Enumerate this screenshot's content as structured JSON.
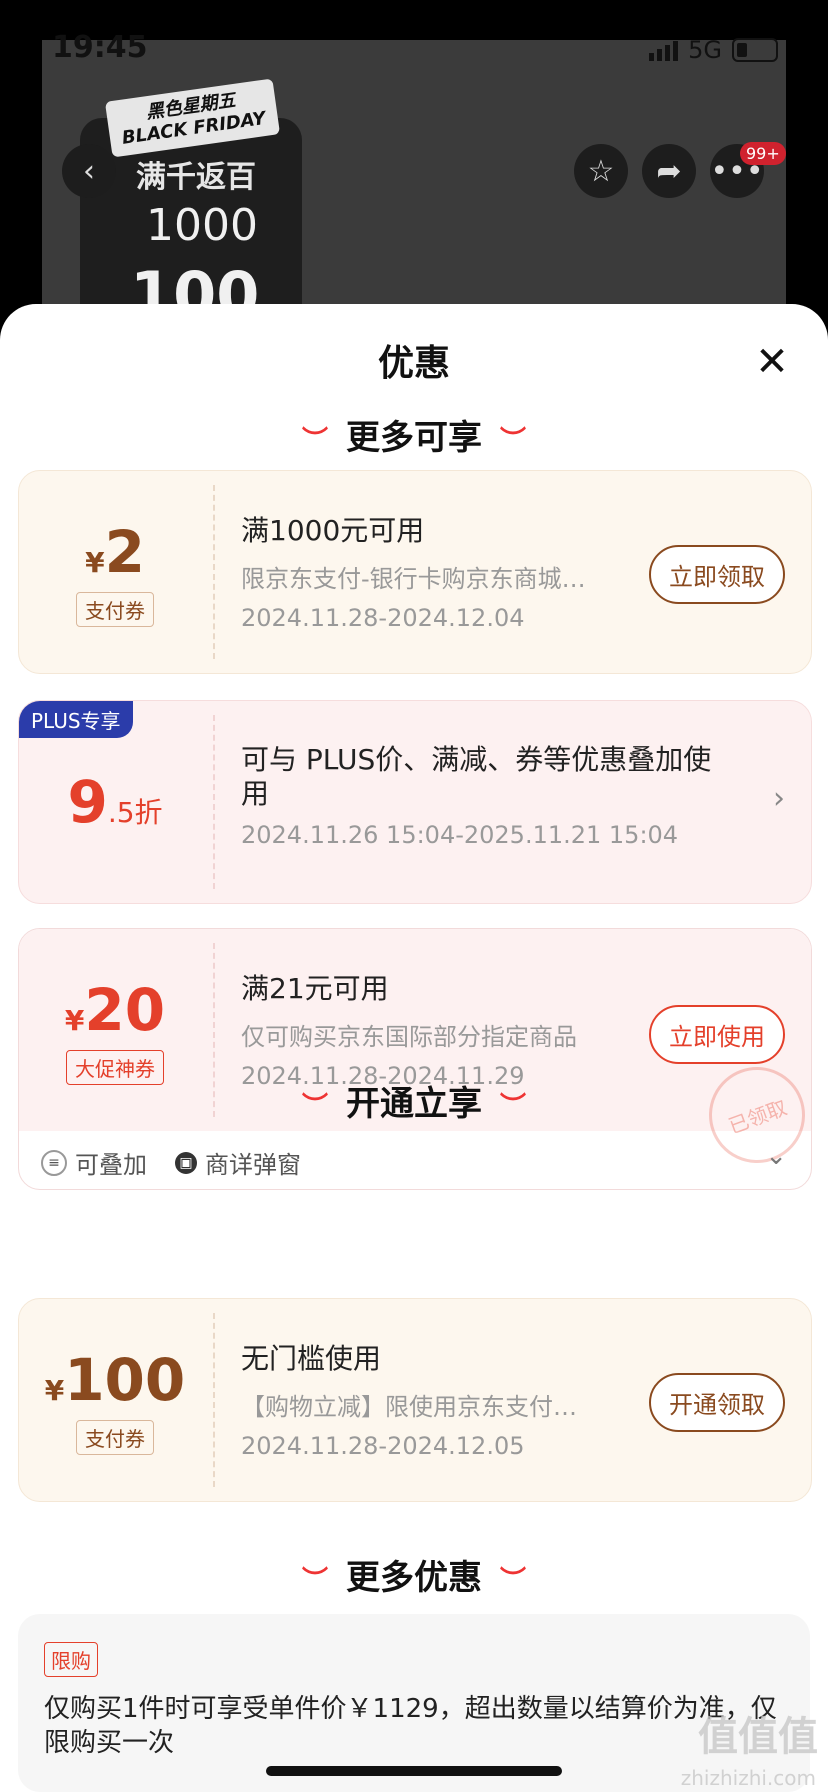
{
  "status_bar": {
    "time": "19:45",
    "network": "5G"
  },
  "product_promo": {
    "tag_line1": "黑色星期五",
    "tag_line2": "BLACK FRIDAY",
    "title": "满千返百",
    "full_amount": "1000",
    "return_amount": "100"
  },
  "header": {
    "badge": "99+"
  },
  "sheet": {
    "title": "优惠",
    "sections": {
      "more_enjoy": "更多可享",
      "open_enjoy": "开通立享",
      "more_discounts": "更多优惠"
    }
  },
  "coupons": [
    {
      "yen": "¥",
      "amount": "2",
      "tag": "支付券",
      "title": "满1000元可用",
      "sub": "限京东支付-银行卡购京东商城…",
      "date": "2024.11.28-2024.12.04",
      "action": "立即领取"
    },
    {
      "plus_tag": "PLUS专享",
      "amount_main": "9",
      "amount_sub": ".5折",
      "title": "可与 PLUS价、满减、券等优惠叠加使用",
      "date": "2024.11.26 15:04-2025.11.21 15:04"
    },
    {
      "yen": "¥",
      "amount": "20",
      "tag": "大促神券",
      "title": "满21元可用",
      "sub": "仅可购买京东国际部分指定商品",
      "date": "2024.11.28-2024.11.29",
      "action": "立即使用",
      "stamp": "已领取",
      "footer_stack": "可叠加",
      "footer_popup": "商详弹窗"
    },
    {
      "yen": "¥",
      "amount": "100",
      "tag": "支付券",
      "title": "无门槛使用",
      "sub": "【购物立减】限使用京东支付…",
      "date": "2024.11.28-2024.12.05",
      "action": "开通领取"
    }
  ],
  "limit": {
    "tag": "限购",
    "text": "仅购买1件时可享受单件价￥1129，超出数量以结算价为准，仅限购买一次"
  },
  "watermark": {
    "main": "值值值",
    "site": "zhizhizhi.com"
  }
}
